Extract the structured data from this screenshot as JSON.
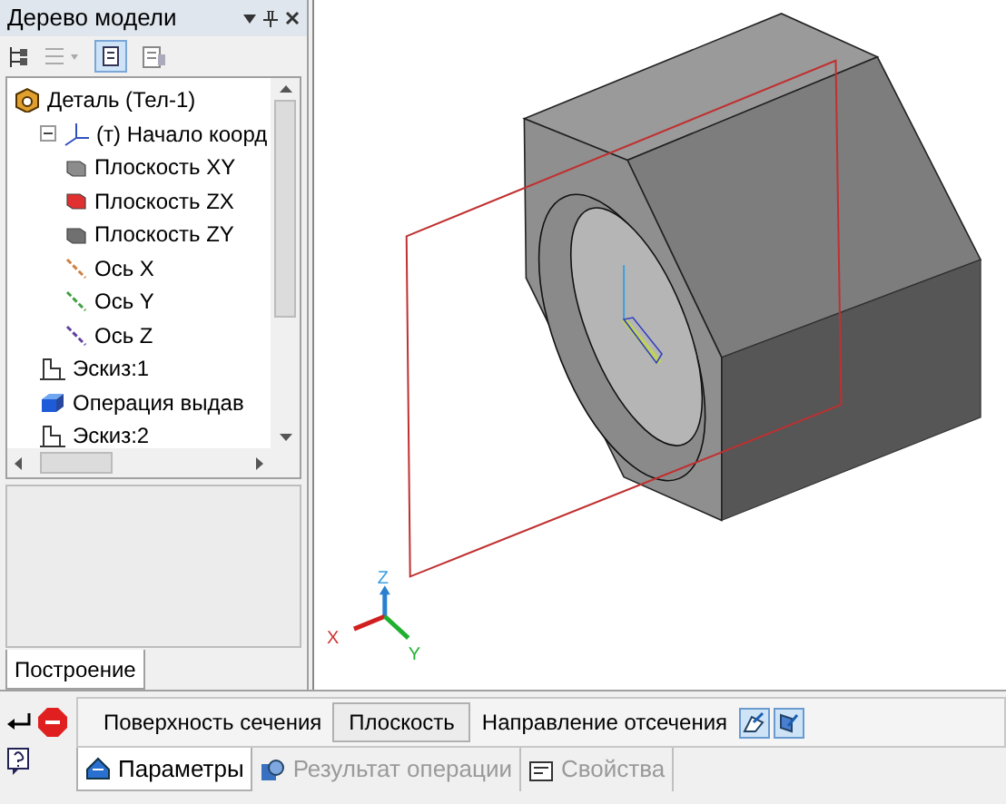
{
  "panel": {
    "title": "Дерево модели",
    "tab": {
      "label": "Построение",
      "selected": true
    }
  },
  "tree": [
    {
      "label": "Деталь (Тел-1)",
      "kind": "part",
      "children": [
        {
          "label": "(т) Начало коорд",
          "kind": "origin",
          "expanded": true,
          "children": [
            {
              "label": "Плоскость XY",
              "kind": "plane",
              "color": "#8c8c8c"
            },
            {
              "label": "Плоскость ZX",
              "kind": "plane",
              "color": "#e03030"
            },
            {
              "label": "Плоскость ZY",
              "kind": "plane",
              "color": "#707070"
            },
            {
              "label": "Ось X",
              "kind": "axis",
              "color": "#d08040"
            },
            {
              "label": "Ось Y",
              "kind": "axis",
              "color": "#40a040"
            },
            {
              "label": "Ось Z",
              "kind": "axis",
              "color": "#6040a0"
            }
          ]
        },
        {
          "label": "Эскиз:1",
          "kind": "sketch"
        },
        {
          "label": "Операция выдав",
          "kind": "extrude"
        },
        {
          "label": "Эскиз:2",
          "kind": "sketch"
        }
      ]
    }
  ],
  "viewport": {
    "axis_labels": [
      "Z",
      "X",
      "Y"
    ]
  },
  "properties": {
    "surface_label": "Поверхность сечения",
    "surface_value": "Плоскость",
    "direction_label": "Направление отсечения",
    "tabs": [
      {
        "label": "Параметры",
        "selected": true,
        "disabled": false
      },
      {
        "label": "Результат операции",
        "selected": false,
        "disabled": true
      },
      {
        "label": "Свойства",
        "selected": false,
        "disabled": true
      }
    ]
  }
}
